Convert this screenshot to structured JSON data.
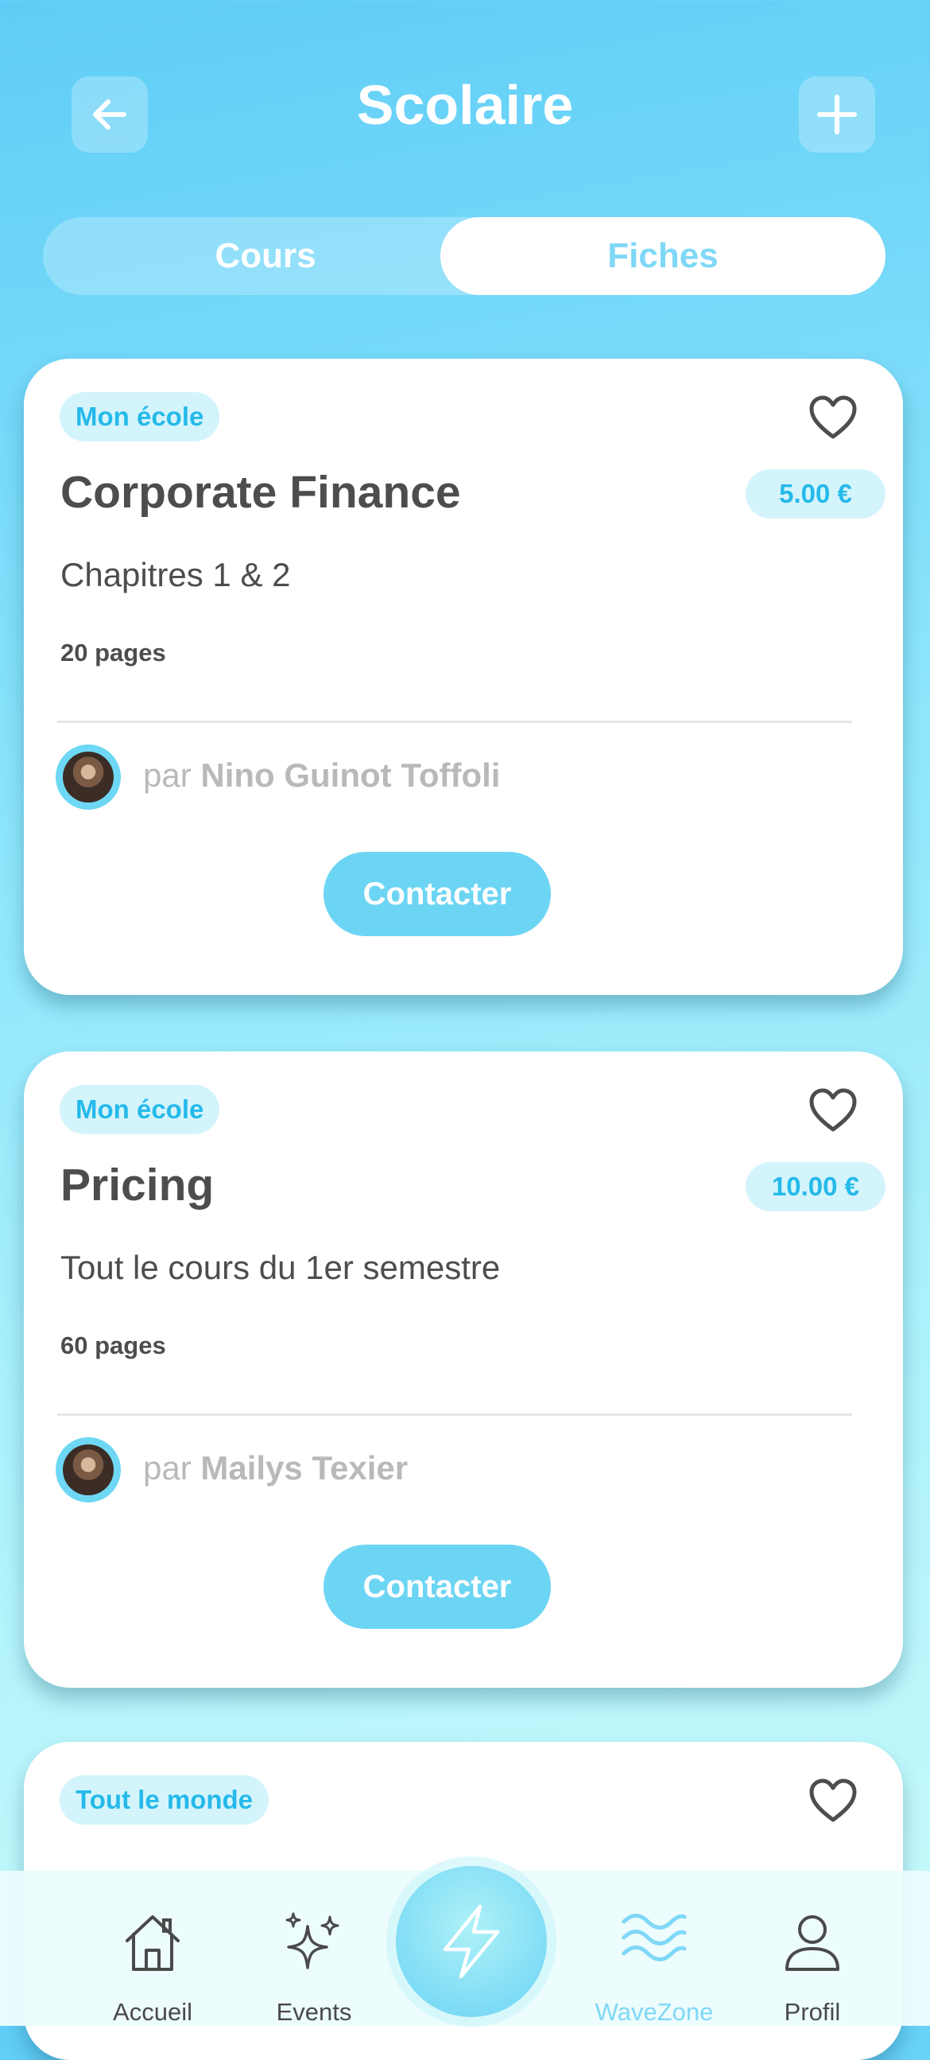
{
  "header": {
    "title": "Scolaire",
    "back_icon": "arrow-left-icon",
    "add_icon": "plus-icon"
  },
  "segment": {
    "left": "Cours",
    "right": "Fiches",
    "selected": "Fiches"
  },
  "cards": [
    {
      "tag": "Mon école",
      "title": "Corporate Finance",
      "price": "5.00 €",
      "subtitle": "Chapitres 1 & 2",
      "pages": "20 pages",
      "by": "par",
      "author": "Nino Guinot Toffoli",
      "button": "Contacter"
    },
    {
      "tag": "Mon école",
      "title": "Pricing",
      "price": "10.00 €",
      "subtitle": "Tout le cours du 1er semestre",
      "pages": "60 pages",
      "by": "par",
      "author": "Mailys Texier",
      "button": "Contacter"
    },
    {
      "tag": "Tout le monde"
    }
  ],
  "tabbar": {
    "items": [
      {
        "label": "Accueil",
        "icon": "home-icon"
      },
      {
        "label": "Events",
        "icon": "sparkles-icon"
      },
      {
        "label": "",
        "icon": "lightning-icon"
      },
      {
        "label": "WaveZone",
        "icon": "waves-icon",
        "active": true
      },
      {
        "label": "Profil",
        "icon": "user-icon"
      }
    ]
  },
  "colors": {
    "accent": "#6dd5f4",
    "tag_text": "#25b9ea",
    "tag_bg": "#d4f4fc",
    "text_dark": "#4d4d4d"
  }
}
